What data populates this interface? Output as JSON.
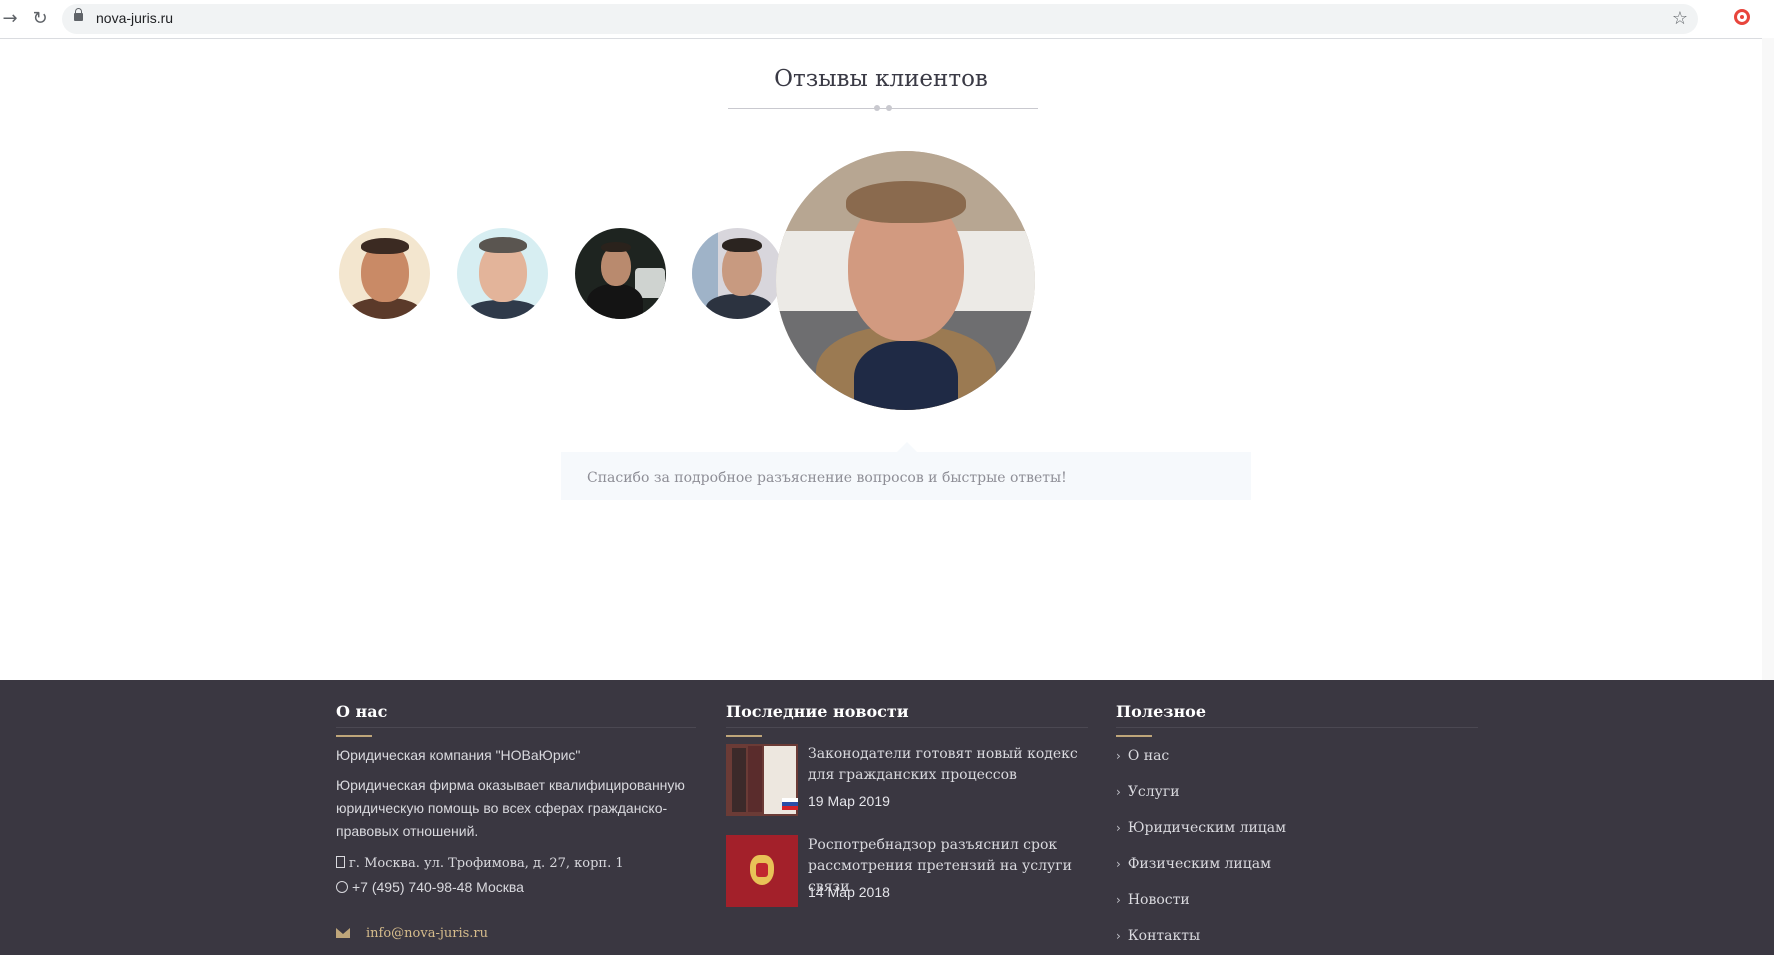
{
  "browser": {
    "url": "nova-juris.ru",
    "back_icon": "arrow-right-icon",
    "reload_icon": "reload-icon",
    "lock_icon": "lock-icon",
    "star_icon": "star-icon",
    "extension_icon": "target-icon"
  },
  "testimonials": {
    "title": "Отзывы клиентов",
    "quote": "Спасибо за подробное разъяснение вопросов и быстрые ответы!",
    "avatars": [
      "client-avatar-1",
      "client-avatar-2",
      "client-avatar-3",
      "client-avatar-4",
      "client-avatar-active"
    ]
  },
  "footer": {
    "about": {
      "title": "О нас",
      "company": "Юридическая компания \"НОВаЮрис\"",
      "description": "Юридическая фирма оказывает квалифицированную юридическую помощь во всех сферах гражданско-правовых отношений.",
      "address": "г. Москва. ул. Трофимова, д. 27, корп. 1",
      "phone": "+7 (495) 740-98-48 Москва",
      "email": "info@nova-juris.ru"
    },
    "news": {
      "title": "Последние новости",
      "items": [
        {
          "title": "Законодатели готовят новый кодекс для гражданских процессов",
          "date": "19 Мар 2019"
        },
        {
          "title": "Роспотребнадзор разъяснил срок рассмотрения претензий на услуги связи",
          "date": "14 Мар 2018"
        }
      ]
    },
    "useful": {
      "title": "Полезное",
      "items": [
        "О нас",
        "Услуги",
        "Юридическим лицам",
        "Физическим лицам",
        "Новости",
        "Контакты"
      ]
    }
  },
  "colors": {
    "footer_bg": "#3a3741",
    "accent": "#bfa67a",
    "quote_bg": "#f6f9fc"
  }
}
